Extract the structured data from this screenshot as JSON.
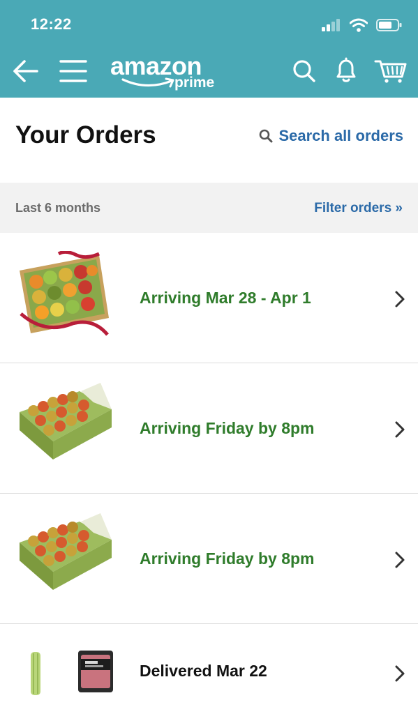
{
  "status_bar": {
    "time": "12:22"
  },
  "header": {
    "logo_word": "amazon",
    "logo_sub": "prime",
    "icons": [
      "back-arrow-icon",
      "hamburger-menu-icon",
      "search-icon",
      "bell-icon",
      "cart-icon"
    ]
  },
  "page": {
    "title": "Your Orders",
    "search_label": "Search all orders"
  },
  "filter": {
    "range": "Last 6 months",
    "link": "Filter orders »"
  },
  "orders": [
    {
      "status": "Arriving Mar 28 - Apr 1",
      "thumbnail": "fruit-gift-box-image"
    },
    {
      "status": "Arriving Friday by 8pm",
      "thumbnail": "pear-box-image"
    },
    {
      "status": "Arriving Friday by 8pm",
      "thumbnail": "pear-box-image"
    },
    {
      "status": "Delivered Mar 22",
      "thumbnail": "celery-and-meat-image"
    }
  ],
  "colors": {
    "header_bg": "#4aa9b6",
    "link_blue": "#2b6aa8",
    "arriving_green": "#2f7c2b",
    "filter_bar_bg": "#f2f2f2"
  }
}
